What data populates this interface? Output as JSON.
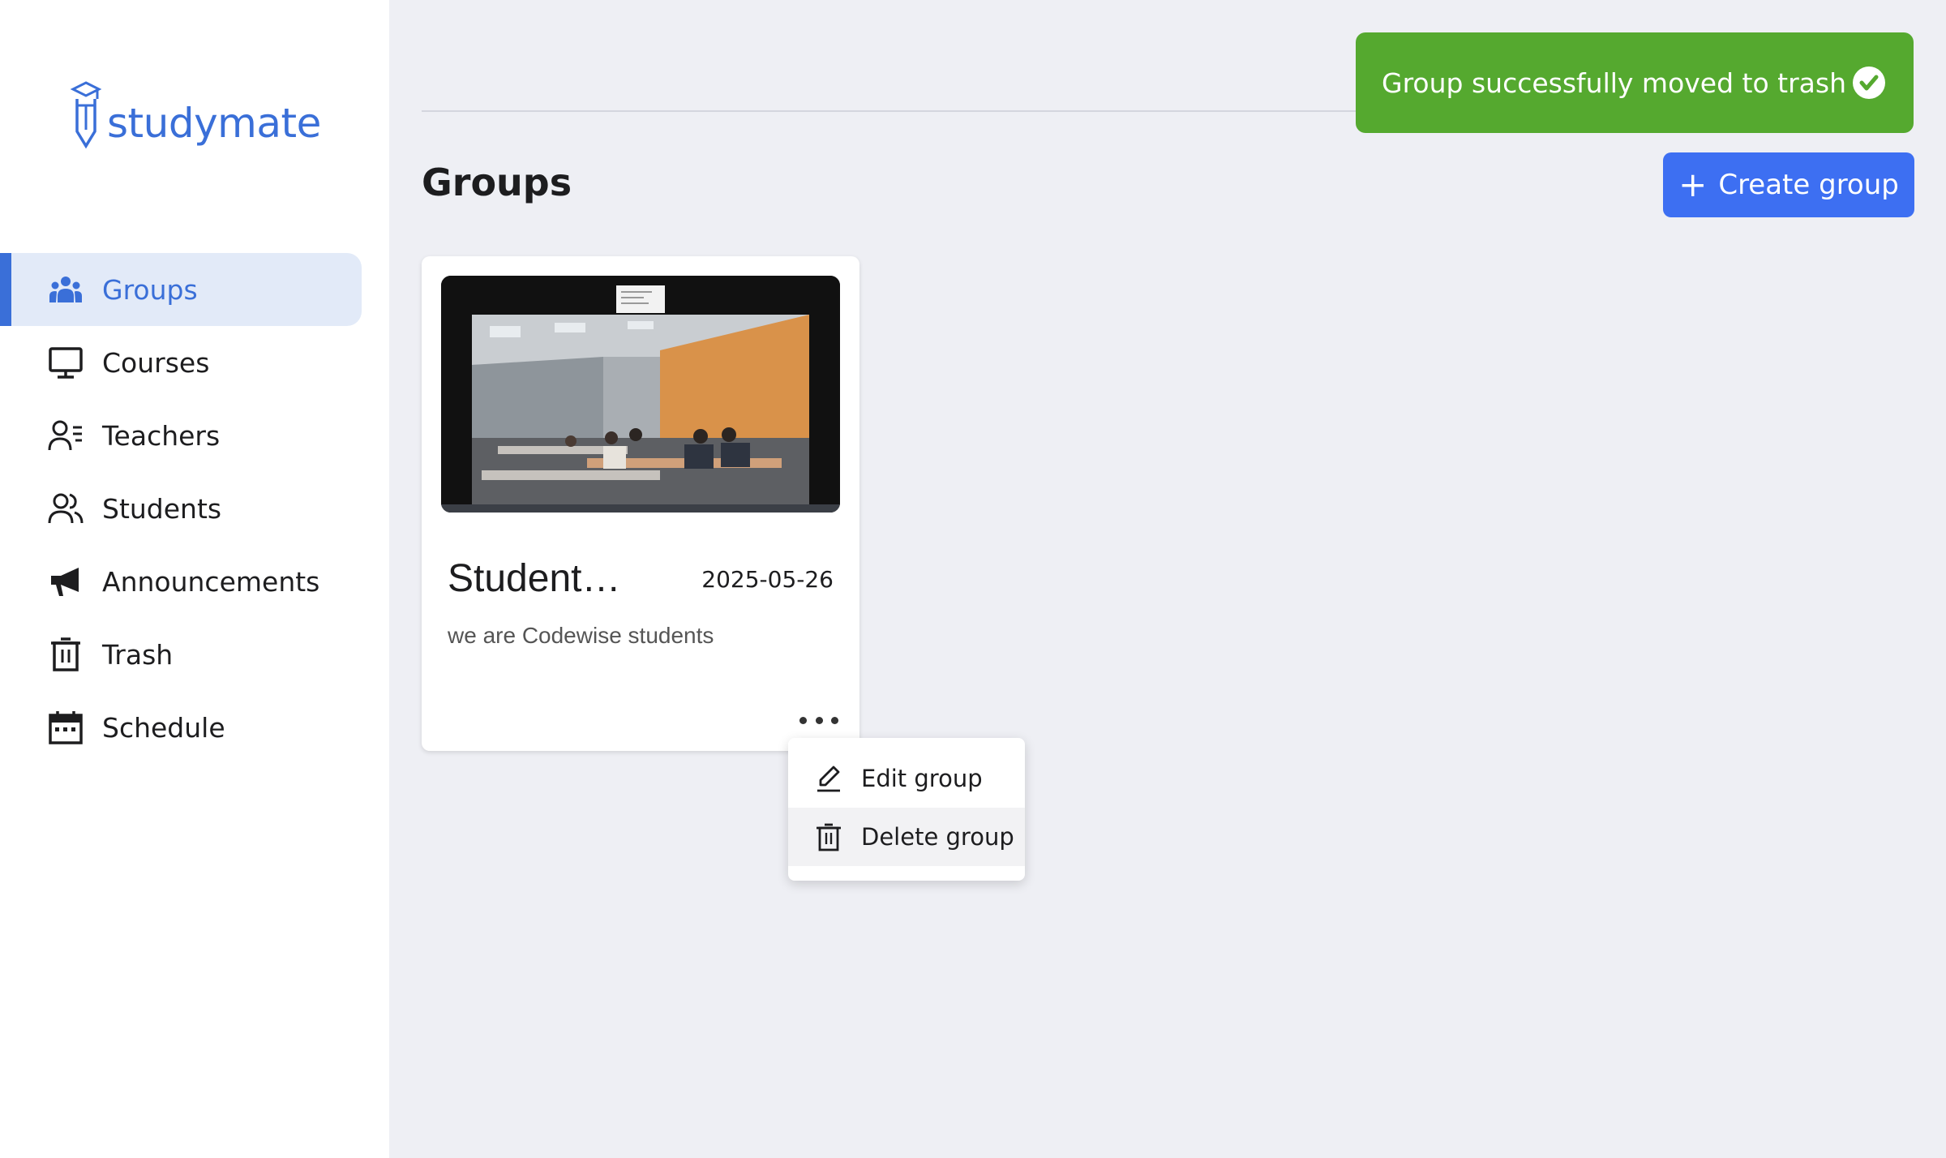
{
  "app": {
    "logo_text": "studymate"
  },
  "sidebar": {
    "items": [
      {
        "label": "Groups",
        "icon": "users-icon",
        "active": true
      },
      {
        "label": "Courses",
        "icon": "monitor-icon"
      },
      {
        "label": "Teachers",
        "icon": "teacher-list-icon"
      },
      {
        "label": "Students",
        "icon": "students-icon"
      },
      {
        "label": "Announcements",
        "icon": "megaphone-icon"
      },
      {
        "label": "Trash",
        "icon": "trash-icon"
      },
      {
        "label": "Schedule",
        "icon": "calendar-icon"
      }
    ]
  },
  "page": {
    "title": "Groups"
  },
  "toolbar": {
    "create_label": "Create group",
    "create_icon": "plus-icon"
  },
  "toast": {
    "message": "Group successfully moved to trash",
    "icon": "check-circle-icon",
    "color": "#55a92f"
  },
  "cards": [
    {
      "title": "Student…",
      "date": "2025-05-26",
      "description": "we are Codewise students",
      "image": "classroom-photo"
    }
  ],
  "menu": {
    "items": [
      {
        "label": "Edit group",
        "icon": "pencil-icon"
      },
      {
        "label": "Delete group",
        "icon": "trash-icon"
      }
    ]
  },
  "colors": {
    "accent": "#3a6fd8",
    "button": "#3d6ff2",
    "active_bg": "#e2eaf8",
    "background": "#eeeff4"
  }
}
